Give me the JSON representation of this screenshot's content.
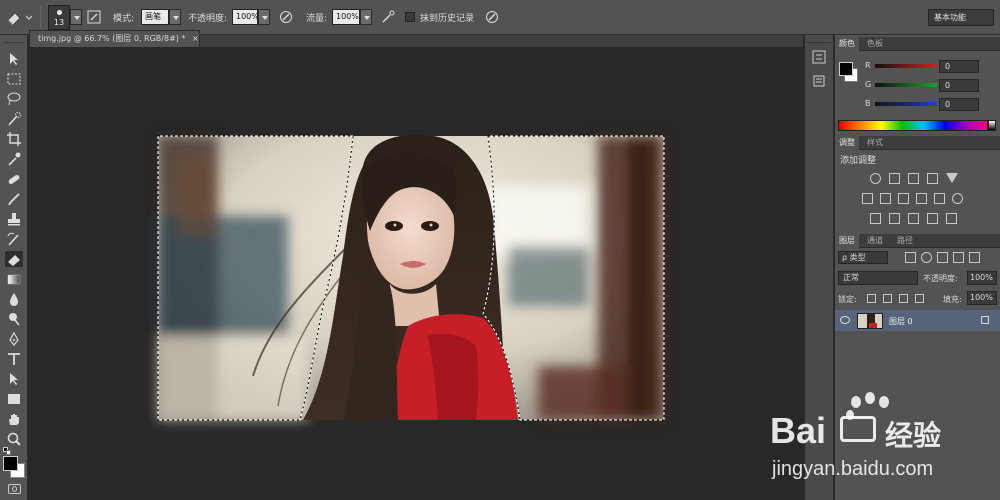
{
  "options_bar": {
    "brush_size": "13",
    "mode_label": "模式:",
    "mode_value": "画笔",
    "opacity_label": "不透明度:",
    "opacity_value": "100%",
    "flow_label": "流量:",
    "flow_value": "100%",
    "history_label": "抹到历史记录",
    "workspace": "基本功能"
  },
  "document_tab": {
    "title": "timg.jpg @ 66.7% (图层 0, RGB/8#) *",
    "close": "×"
  },
  "color_panel": {
    "tabs": [
      "颜色",
      "色板"
    ],
    "channels": [
      {
        "label": "R",
        "value": "0",
        "color": "#d42020"
      },
      {
        "label": "G",
        "value": "0",
        "color": "#20a030"
      },
      {
        "label": "B",
        "value": "0",
        "color": "#2040d0"
      }
    ]
  },
  "adjust_panel": {
    "tabs": [
      "调整",
      "样式"
    ],
    "title": "添加调整"
  },
  "layers_panel": {
    "tabs": [
      "图层",
      "通道",
      "路径"
    ],
    "filter_label": "ρ 类型",
    "blend_mode": "正常",
    "opacity_label": "不透明度:",
    "opacity_value": "100%",
    "lock_label": "锁定:",
    "fill_label": "填充:",
    "fill_value": "100%",
    "layer_name": "图层 0"
  },
  "watermark": {
    "brand_left": "Bai",
    "brand_right": "经验",
    "url": "jingyan.baidu.com"
  },
  "colors": {
    "ui_bg": "#535353",
    "canvas_bg": "#282828",
    "accent_red": "#c81e28"
  }
}
